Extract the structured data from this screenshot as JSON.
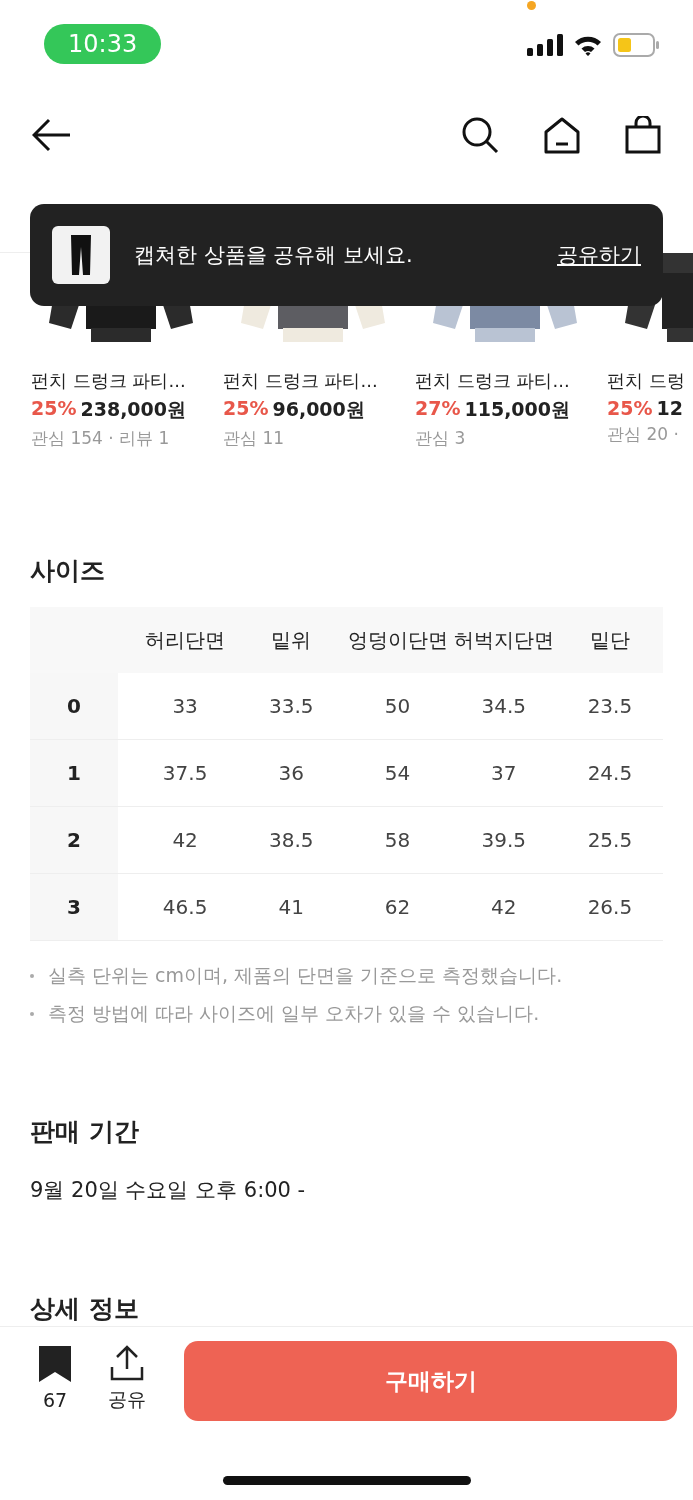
{
  "status_bar": {
    "time": "10:33"
  },
  "toast": {
    "message": "캡쳐한 상품을 공유해 보세요.",
    "action": "공유하기"
  },
  "products": [
    {
      "name": "펀치 드렁크 파티...",
      "discount": "25%",
      "price": "238,000원",
      "meta": "관심 154 · 리뷰 1"
    },
    {
      "name": "펀치 드렁크 파티...",
      "discount": "25%",
      "price": "96,000원",
      "meta": "관심 11"
    },
    {
      "name": "펀치 드렁크 파티...",
      "discount": "27%",
      "price": "115,000원",
      "meta": "관심 3"
    },
    {
      "name": "펀치 드렁",
      "discount": "25%",
      "price": "12",
      "meta": "관심 20 ·"
    }
  ],
  "size_section": {
    "title": "사이즈",
    "table": {
      "columns": [
        "허리단면",
        "밑위",
        "엉덩이단면",
        "허벅지단면",
        "밑단"
      ],
      "rows": [
        {
          "size": "0",
          "cells": [
            "33",
            "33.5",
            "50",
            "34.5",
            "23.5"
          ]
        },
        {
          "size": "1",
          "cells": [
            "37.5",
            "36",
            "54",
            "37",
            "24.5"
          ]
        },
        {
          "size": "2",
          "cells": [
            "42",
            "38.5",
            "58",
            "39.5",
            "25.5"
          ]
        },
        {
          "size": "3",
          "cells": [
            "46.5",
            "41",
            "62",
            "42",
            "26.5"
          ]
        }
      ]
    },
    "notes": [
      "실측 단위는 cm이며, 제품의 단면을 기준으로 측정했습니다.",
      "측정 방법에 따라 사이즈에 일부 오차가 있을 수 있습니다."
    ]
  },
  "sale_period": {
    "title": "판매 기간",
    "value": "9월 20일 수요일 오후 6:00 -"
  },
  "detail_section": {
    "title": "상세 정보"
  },
  "bottom_bar": {
    "bookmark_count": "67",
    "share_label": "공유",
    "buy_label": "구매하기"
  }
}
